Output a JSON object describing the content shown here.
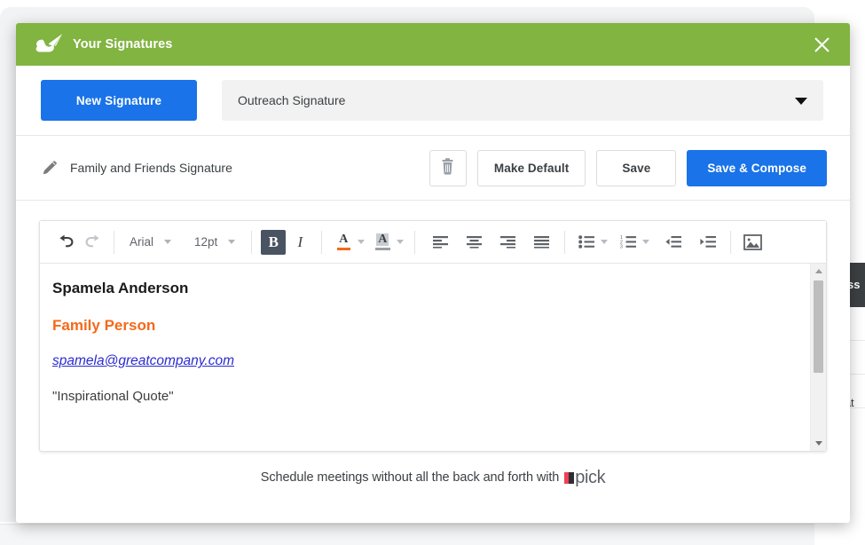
{
  "window": {
    "title": "Your Signatures",
    "logo_icon": "cloud-paper-plane-icon",
    "close_icon": "close-x-icon",
    "header_color": "#81b441"
  },
  "toolbar_row": {
    "new_signature_label": "New Signature",
    "new_signature_color": "#1a73e8",
    "selected_signature": "Outreach Signature",
    "dropdown_icon": "chevron-down-icon"
  },
  "actions_row": {
    "edit_icon": "pencil-icon",
    "signature_name": "Family and Friends Signature",
    "delete_icon": "trash-icon",
    "make_default_label": "Make Default",
    "save_label": "Save",
    "save_compose_label": "Save & Compose",
    "save_compose_color": "#1a73e8"
  },
  "editor": {
    "toolbar": {
      "undo_icon": "undo-arrow-icon",
      "redo_icon": "redo-arrow-icon",
      "font_family": "Arial",
      "font_size": "12pt",
      "bold_label": "B",
      "bold_active": true,
      "italic_label": "I",
      "text_color_label": "A",
      "text_color_swatch": "#f4691a",
      "highlight_label": "A",
      "highlight_swatch": "#bdbdbd",
      "align_left_icon": "align-left-icon",
      "align_center_icon": "align-center-icon",
      "align_right_icon": "align-right-icon",
      "align_justify_icon": "align-justify-icon",
      "bullet_list_icon": "bullet-list-icon",
      "numbered_list_icon": "numbered-list-icon",
      "outdent_icon": "outdent-icon",
      "indent_icon": "indent-icon",
      "insert_image_icon": "insert-image-icon"
    },
    "content": {
      "name": "Spamela Anderson",
      "role": "Family Person",
      "role_color": "#f4691a",
      "email": "spamela@greatcompany.com",
      "email_color": "#2b2bd0",
      "quote": "\"Inspirational Quote\""
    },
    "scrollbar": {
      "up_icon": "scroll-up-arrow-icon",
      "down_icon": "scroll-down-arrow-icon"
    }
  },
  "footer": {
    "tagline": "Schedule meetings without all the back and forth with",
    "brand": "pick",
    "brand_mark_color_a": "#ef4056",
    "brand_mark_color_b": "#2d2d35"
  },
  "background": {
    "dark_chip_text": "ss",
    "row_text": "at"
  }
}
